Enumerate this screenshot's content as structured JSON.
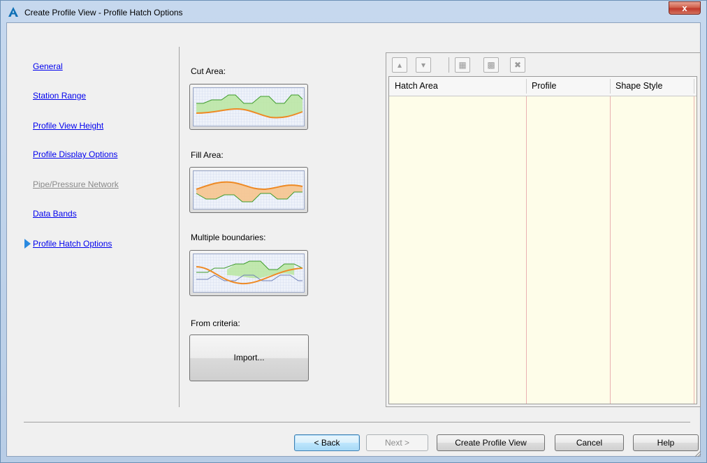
{
  "window": {
    "title": "Create Profile View - Profile Hatch Options",
    "close_label": "x"
  },
  "nav": {
    "items": [
      {
        "label": "General",
        "state": "link"
      },
      {
        "label": "Station Range",
        "state": "link"
      },
      {
        "label": "Profile View Height",
        "state": "link"
      },
      {
        "label": "Profile Display Options",
        "state": "link"
      },
      {
        "label": "Pipe/Pressure Network",
        "state": "disabled"
      },
      {
        "label": "Data Bands",
        "state": "link"
      },
      {
        "label": "Profile Hatch Options",
        "state": "current"
      }
    ]
  },
  "options": {
    "cut_area_label": "Cut Area:",
    "fill_area_label": "Fill Area:",
    "multiple_boundaries_label": "Multiple boundaries:",
    "from_criteria_label": "From criteria:",
    "import_label": "Import..."
  },
  "table": {
    "columns": [
      "Hatch Area",
      "Profile",
      "Shape Style"
    ],
    "rows": []
  },
  "toolbar": {
    "icons": [
      "move-up-icon",
      "move-down-icon",
      "add-hatch-icon",
      "add-hatch-all-icon",
      "delete-icon"
    ]
  },
  "footer": {
    "back_label": "< Back",
    "next_label": "Next >",
    "create_label": "Create Profile View",
    "cancel_label": "Cancel",
    "help_label": "Help"
  },
  "colors": {
    "link": "#0000ee",
    "disabled": "#8a8a8a",
    "nav_arrow": "#2a8ae0",
    "table_background": "#fefde9",
    "cut_fill": "#b8e6a0",
    "fill_fill": "#f6c48e",
    "profile_line": "#ee8a25",
    "close_button": "#c0392b"
  }
}
